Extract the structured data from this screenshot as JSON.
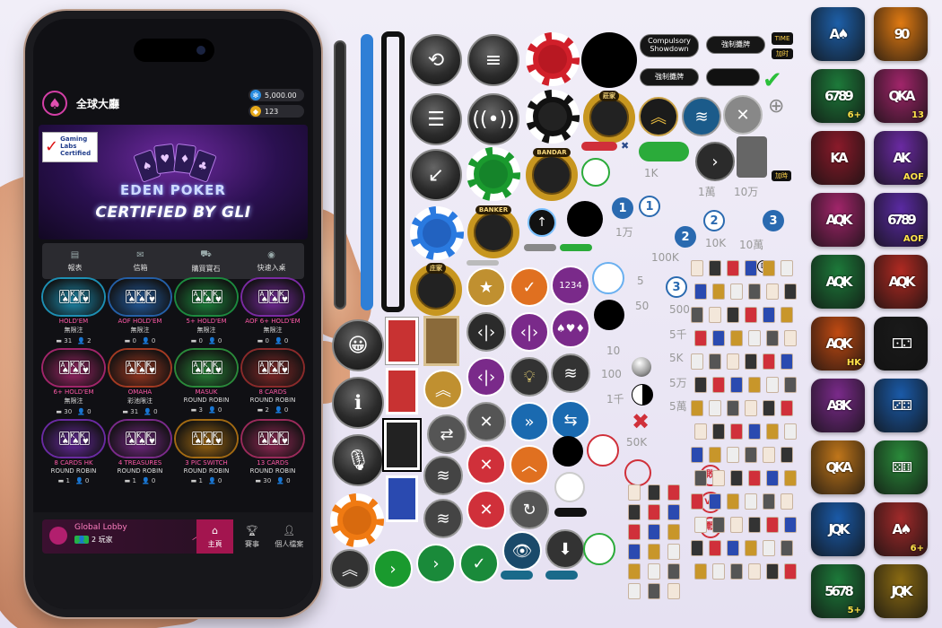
{
  "phone": {
    "lobby_title": "全球大廳",
    "balance_coins": "5,000.00",
    "balance_gems": "123",
    "banner": {
      "badge_line1": "Gaming",
      "badge_line2": "Labs",
      "badge_line3": "Certified",
      "brand": "EDEN POKER",
      "headline": "CERTIFIED BY GLI"
    },
    "quickbar": [
      "報表",
      "信箱",
      "購買寶石",
      "快速入桌"
    ],
    "games": [
      {
        "name": "HOLD'EM",
        "sub": "無限注",
        "players": "31",
        "friends": "2",
        "color": "#1d8fb3"
      },
      {
        "name": "AOF HOLD'EM",
        "sub": "無限注",
        "players": "0",
        "friends": "0",
        "color": "#245fa6"
      },
      {
        "name": "5+ HOLD'EM",
        "sub": "無限注",
        "players": "0",
        "friends": "0",
        "color": "#1c8a3e"
      },
      {
        "name": "AOF 6+ HOLD'EM",
        "sub": "無限注",
        "players": "0",
        "friends": "0",
        "color": "#7a2aa2"
      },
      {
        "name": "6+ HOLD'EM",
        "sub": "無限注",
        "players": "30",
        "friends": "0",
        "color": "#a1256a"
      },
      {
        "name": "OMAHA",
        "sub": "彩池限注",
        "players": "31",
        "friends": "0",
        "color": "#a33a22"
      },
      {
        "name": "MASUK",
        "sub": "ROUND ROBIN",
        "players": "3",
        "friends": "0",
        "color": "#2a8a3a"
      },
      {
        "name": "8 CARDS",
        "sub": "ROUND ROBIN",
        "players": "2",
        "friends": "0",
        "color": "#8a2a2a"
      },
      {
        "name": "8 CARDS HK",
        "sub": "ROUND ROBIN",
        "players": "1",
        "friends": "0",
        "color": "#6a2aa2"
      },
      {
        "name": "4 TREASURES",
        "sub": "ROUND ROBIN",
        "players": "1",
        "friends": "0",
        "color": "#7a2a8a"
      },
      {
        "name": "3 PIC SWITCH",
        "sub": "ROUND ROBIN",
        "players": "1",
        "friends": "0",
        "color": "#a26a12"
      },
      {
        "name": "13 CARDS",
        "sub": "ROUND ROBIN",
        "players": "30",
        "friends": "0",
        "color": "#9a2a5a"
      }
    ],
    "global_lobby": "Global Lobby",
    "global_players": "2 玩家",
    "tabs": [
      "主頁",
      "賽事",
      "個人檔案"
    ]
  },
  "assets": {
    "pill_compulsory": "Compulsory Showdown",
    "pill_force1": "強制攤牌",
    "pill_force2": "強制攤牌",
    "time_label": "TIME",
    "extra_time": "加时",
    "extra_time2": "加時",
    "ring_zhuangjia": "莊家",
    "ring_bandar": "BANDAR",
    "ring_banker": "BANKER",
    "ring_zhuangjia2": "庄家",
    "amounts_a": [
      "1K",
      "1萬",
      "10万"
    ],
    "amounts_b": [
      "1万",
      "10K",
      "10萬"
    ],
    "amounts_c": "100K",
    "amounts_d": [
      "5",
      "50",
      "500",
      "10",
      "5千",
      "100",
      "5K",
      "1千",
      "5万",
      "50K",
      "5萬"
    ],
    "dice_label": "1234",
    "num_circles": [
      "1",
      "1",
      "2",
      "2",
      "3",
      "3"
    ],
    "vs_labels": [
      "敗",
      "VS",
      "戰"
    ],
    "d_label": "D",
    "p_label": "P"
  },
  "apps": [
    {
      "cards": "A♠",
      "tag": "",
      "color": "#1d5fa8"
    },
    {
      "cards": "90",
      "tag": "",
      "color": "#e07a12"
    },
    {
      "cards": "6789",
      "tag": "6+",
      "color": "#1d7a3a"
    },
    {
      "cards": "QKA",
      "tag": "13",
      "color": "#a1256a"
    },
    {
      "cards": "KA",
      "tag": "",
      "color": "#8a1a2a"
    },
    {
      "cards": "AK",
      "tag": "AOF",
      "color": "#6a2aa2"
    },
    {
      "cards": "AQK",
      "tag": "",
      "color": "#a1256a"
    },
    {
      "cards": "6789",
      "tag": "AOF",
      "color": "#5a2aa2"
    },
    {
      "cards": "AQK",
      "tag": "",
      "color": "#1d7a3a"
    },
    {
      "cards": "AQK",
      "tag": "",
      "color": "#b02a22"
    },
    {
      "cards": "AQK",
      "tag": "HK",
      "color": "#c04a12"
    },
    {
      "cards": "⚀⚁",
      "tag": "",
      "color": "#1a1a1a"
    },
    {
      "cards": "A8K",
      "tag": "",
      "color": "#7a2a8a"
    },
    {
      "cards": "⚂⚃",
      "tag": "",
      "color": "#1a5aa8"
    },
    {
      "cards": "QKA",
      "tag": "",
      "color": "#c0761a"
    },
    {
      "cards": "⚄⚅",
      "tag": "",
      "color": "#2a8a3a"
    },
    {
      "cards": "JQK",
      "tag": "",
      "color": "#1a5aa8"
    },
    {
      "cards": "A♠",
      "tag": "6+",
      "color": "#a02a2a"
    },
    {
      "cards": "5678",
      "tag": "5+",
      "color": "#1d7a3a"
    },
    {
      "cards": "JQK",
      "tag": "",
      "color": "#8a6a12"
    }
  ]
}
